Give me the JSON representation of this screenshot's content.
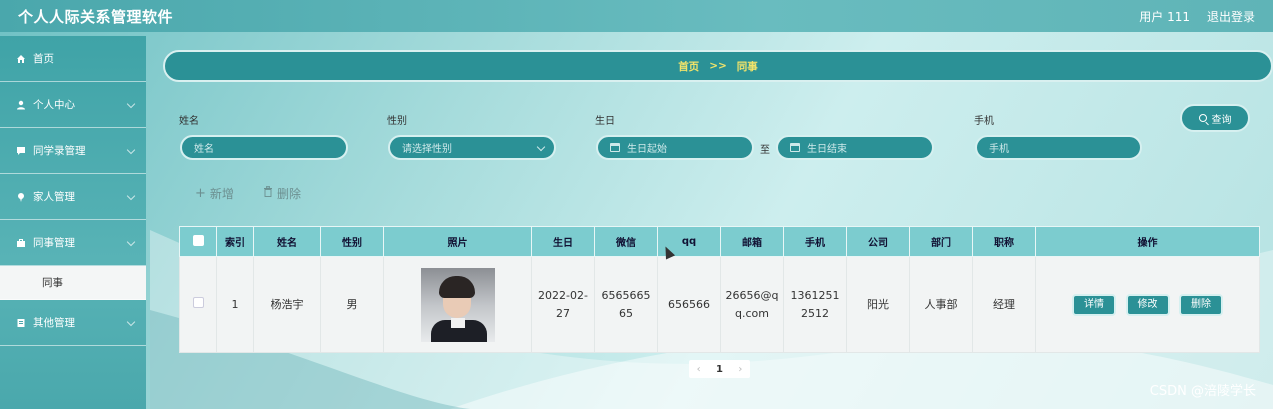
{
  "app": {
    "title": "个人人际关系管理软件",
    "user": "用户 111",
    "logout": "退出登录"
  },
  "sidebar": {
    "items": [
      {
        "label": "首页",
        "icon": "home-icon",
        "expandable": false
      },
      {
        "label": "个人中心",
        "icon": "user-icon",
        "expandable": true
      },
      {
        "label": "同学录管理",
        "icon": "chat-icon",
        "expandable": true
      },
      {
        "label": "家人管理",
        "icon": "pin-icon",
        "expandable": true
      },
      {
        "label": "同事管理",
        "icon": "briefcase-icon",
        "expandable": true,
        "sub": [
          "同事"
        ]
      },
      {
        "label": "其他管理",
        "icon": "doc-icon",
        "expandable": true
      }
    ]
  },
  "breadcrumb": {
    "home": "首页",
    "sep": ">>",
    "current": "同事"
  },
  "filters": {
    "name": {
      "label": "姓名",
      "placeholder": "姓名"
    },
    "gender": {
      "label": "性别",
      "placeholder": "请选择性别"
    },
    "birthday": {
      "label": "生日",
      "start_placeholder": "生日起始",
      "to": "至",
      "end_placeholder": "生日结束"
    },
    "phone": {
      "label": "手机",
      "placeholder": "手机"
    },
    "search": "查询"
  },
  "actions": {
    "add": "新增",
    "delete": "删除"
  },
  "table": {
    "headers": [
      "索引",
      "姓名",
      "性别",
      "照片",
      "生日",
      "微信",
      "qq",
      "邮箱",
      "手机",
      "公司",
      "部门",
      "职称",
      "操作"
    ],
    "rows": [
      {
        "index": "1",
        "name": "杨浩宇",
        "gender": "男",
        "birthday": "2022-02-27",
        "wechat": "656566565",
        "qq": "656566",
        "email": "26656@qq.com",
        "phone": "13612512512",
        "company": "阳光",
        "dept": "人事部",
        "title": "经理"
      }
    ],
    "row_buttons": {
      "detail": "详情",
      "edit": "修改",
      "delete": "删除"
    }
  },
  "pager": {
    "prev": "‹",
    "page": "1",
    "next": "›"
  },
  "watermark": "CSDN @涪陵学长",
  "colors": {
    "primary": "#2b9196",
    "header": "#7ccccf",
    "accent_text": "#f1e36a"
  }
}
